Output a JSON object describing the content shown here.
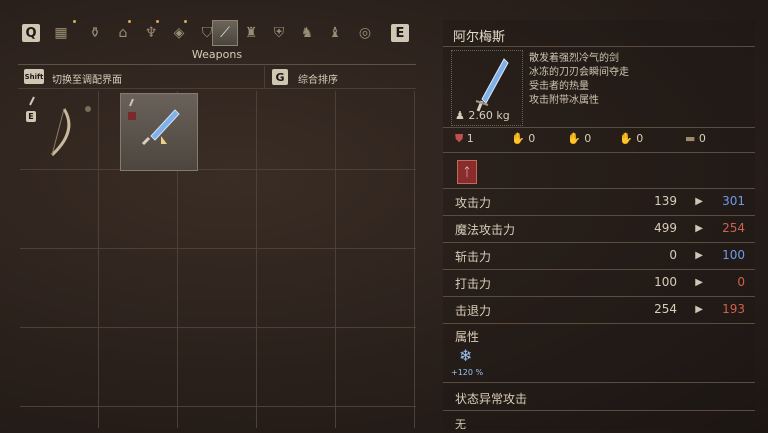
{
  "tabs": {
    "left_key": "Q",
    "right_key": "E",
    "icons": [
      "grid-icon",
      "flask-icon",
      "lantern-icon",
      "cloth-icon",
      "ring-icon",
      "sword-icon",
      "helmet-icon",
      "chest-armor-icon",
      "boots-icon",
      "leg-armor-icon",
      "shield-icon"
    ],
    "active_index": 5
  },
  "category_title": "Weapons",
  "subbar": {
    "shift_key": "Shift",
    "switch_label": "切换至调配界面",
    "g_key": "G",
    "sort_label": "综合排序"
  },
  "inventory": {
    "slots": [
      {
        "item": "curved-bow",
        "equipped_key": "E"
      },
      {
        "item": "frost-sword",
        "selected": true
      }
    ]
  },
  "item": {
    "name": "阿尔梅斯",
    "description": [
      "散发着强烈冷气的剑",
      "冰冻的刀刃会瞬间夺走",
      "受击者的热量",
      "攻击附带冰属性"
    ],
    "weight": "2.60 kg",
    "requirements": [
      {
        "icon": "strength-icon",
        "value": "1",
        "color": "red"
      },
      {
        "icon": "magic-hand-icon",
        "value": "0",
        "color": "blue"
      },
      {
        "icon": "dex-hand-icon",
        "value": "0",
        "color": "gold"
      },
      {
        "icon": "faith-hand-icon",
        "value": "0",
        "color": "gold"
      },
      {
        "icon": "chest-icon",
        "value": "0",
        "color": "gold"
      }
    ],
    "stats": [
      {
        "name": "攻击力",
        "base": "139",
        "new": "301",
        "trend": "up"
      },
      {
        "name": "魔法攻击力",
        "base": "499",
        "new": "254",
        "trend": "down"
      },
      {
        "name": "斩击力",
        "base": "0",
        "new": "100",
        "trend": "up"
      },
      {
        "name": "打击力",
        "base": "100",
        "new": "0",
        "trend": "down"
      },
      {
        "name": "击退力",
        "base": "254",
        "new": "193",
        "trend": "down"
      }
    ],
    "attribute_label": "属性",
    "attribute_value": "+120 %",
    "status_label": "状态异常攻击",
    "status_value": "无"
  },
  "colors": {
    "up": "#6f9ae8",
    "down": "#d06050"
  }
}
